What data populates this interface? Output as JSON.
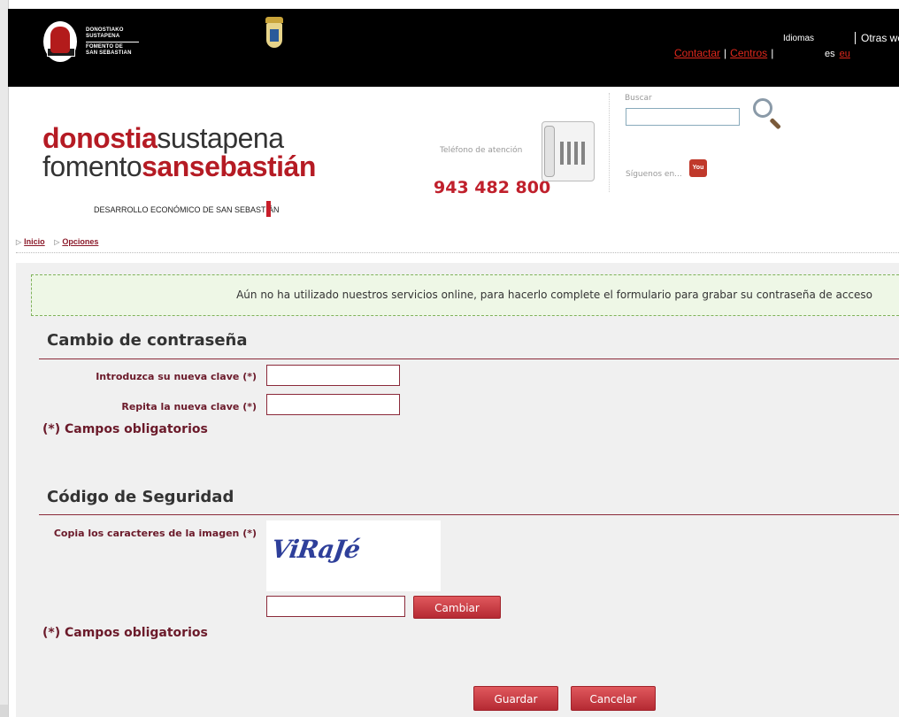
{
  "topbar": {
    "logo_text": [
      "DONOSTIAKO",
      "SUSTAPENA",
      "FOMENTO DE",
      "SAN SEBASTIAN"
    ],
    "links": {
      "contactar": "Contactar",
      "centros": "Centros"
    },
    "idiomas_label": "Idiomas",
    "lang_current": "es",
    "lang_other": "eu",
    "otras_webs": "Otras we"
  },
  "header": {
    "brand_line1_red": "donostia",
    "brand_line1_dark": "sustapena",
    "brand_line2_dark": "fomento",
    "brand_line2_red": "sansebastián",
    "brand_sub": "DESARROLLO ECONÓMICO DE SAN SEBASTIÁN",
    "phone_label": "Teléfono de atención",
    "phone_number": "943 482 800",
    "search_label": "Buscar",
    "search_value": "",
    "follow_label": "Síguenos en...",
    "youtube_text": "You"
  },
  "breadcrumb": {
    "items": [
      "Inicio",
      "Opciones"
    ]
  },
  "notice": "Aún no ha utilizado nuestros servicios online, para hacerlo complete el formulario para grabar su contraseña de acceso",
  "password_section": {
    "title": "Cambio de contraseña",
    "new_label": "Introduzca su nueva clave (*)",
    "new_value": "",
    "repeat_label": "Repita la nueva clave (*)",
    "repeat_value": "",
    "required_note": "(*) Campos obligatorios"
  },
  "security_section": {
    "title": "Código de Seguridad",
    "captcha_label": "Copia los caracteres de la imagen (*)",
    "captcha_text": "ViRaJé",
    "captcha_value": "",
    "change_button": "Cambiar",
    "required_note": "(*) Campos obligatorios"
  },
  "actions": {
    "save": "Guardar",
    "cancel": "Cancelar"
  },
  "colors": {
    "brand_red": "#b51b24",
    "label_maroon": "#6b1a2a",
    "button_red": "#c83a42",
    "notice_bg": "#eef7e6"
  }
}
